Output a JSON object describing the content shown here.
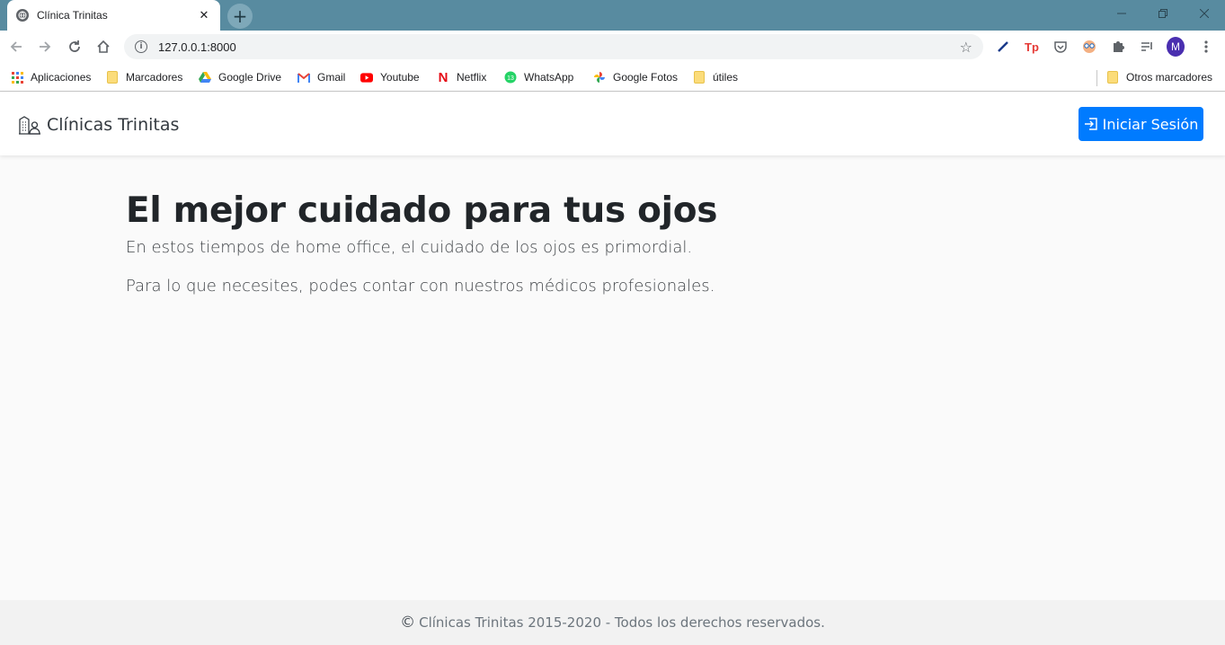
{
  "browser": {
    "tab_title": "Clínica Trinitas",
    "url": "127.0.0.1:8000",
    "profile_initial": "M",
    "bookmarks": [
      {
        "label": "Aplicaciones",
        "icon": "apps-grid-icon"
      },
      {
        "label": "Marcadores",
        "icon": "folder-icon"
      },
      {
        "label": "Google Drive",
        "icon": "google-drive-icon"
      },
      {
        "label": "Gmail",
        "icon": "gmail-icon"
      },
      {
        "label": "Youtube",
        "icon": "youtube-icon"
      },
      {
        "label": "Netflix",
        "icon": "netflix-icon"
      },
      {
        "label": "WhatsApp",
        "icon": "whatsapp-icon"
      },
      {
        "label": "Google Fotos",
        "icon": "google-photos-icon"
      },
      {
        "label": "útiles",
        "icon": "folder-icon"
      }
    ],
    "other_bookmarks": "Otros marcadores",
    "colors": {
      "titlebar": "#588ba0",
      "profile": "#4a2fb0"
    }
  },
  "navbar": {
    "brand": "Clínicas Trinitas",
    "brand_icon": "hospital-person-icon",
    "login_label": "Iniciar Sesión",
    "login_icon": "box-arrow-in-right-icon",
    "accent": "#007bff"
  },
  "hero": {
    "title": "El mejor cuidado para tus ojos",
    "p1": "En estos tiempos de home office, el cuidado de los ojos es primordial.",
    "p2": "Para lo que necesites, podes contar con nuestros médicos profesionales."
  },
  "footer": {
    "copy_symbol": "©",
    "text": "Clínicas Trinitas 2015-2020 - Todos los derechos reservados."
  }
}
